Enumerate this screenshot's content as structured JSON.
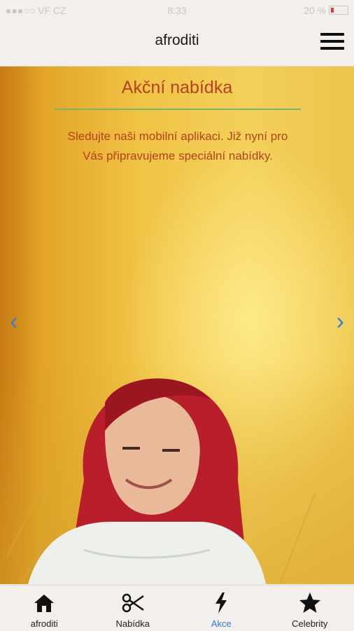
{
  "status_bar": {
    "carrier": "●●●○○ VF CZ",
    "time": "8:33",
    "battery": "20 %"
  },
  "header": {
    "title": "afroditi"
  },
  "promo": {
    "title": "Akční nabídka",
    "text": "Sledujte naši mobilní aplikaci. Již nyní pro Vás připravujeme speciální nabídky."
  },
  "carousel": {
    "prev": "‹",
    "next": "›"
  },
  "tabs": [
    {
      "label": "afroditi",
      "icon": "home-icon"
    },
    {
      "label": "Nabídka",
      "icon": "scissors-icon"
    },
    {
      "label": "Akce",
      "icon": "lightning-icon"
    },
    {
      "label": "Celebrity",
      "icon": "star-icon"
    }
  ],
  "colors": {
    "accent": "#2f7fd8",
    "promo_text": "#b5421c",
    "divider": "#79b56a"
  }
}
